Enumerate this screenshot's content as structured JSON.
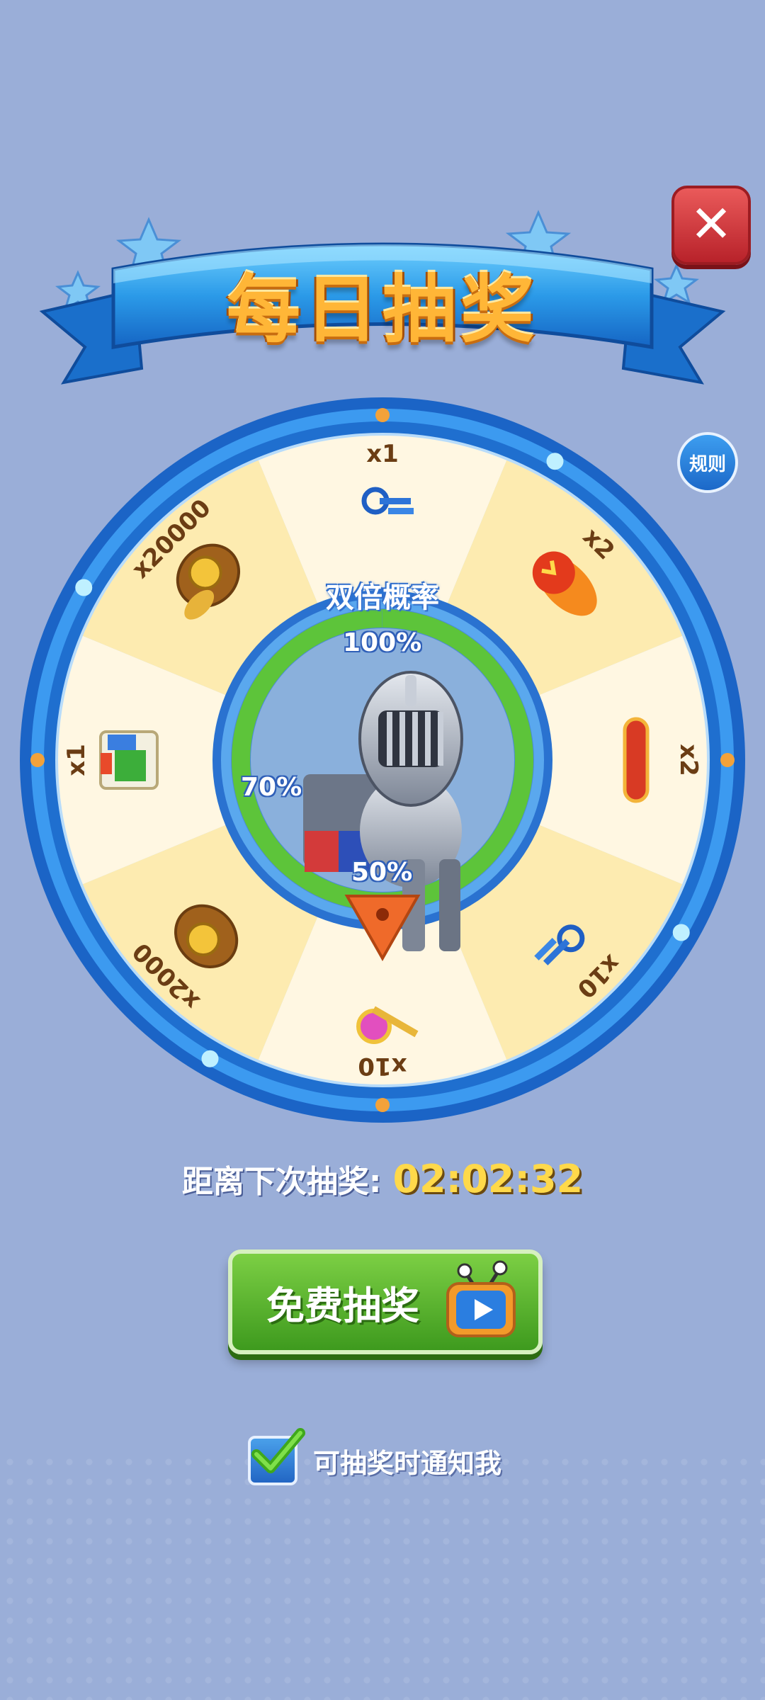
{
  "header": {
    "title": "每日抽奖",
    "close_icon": "close-icon",
    "rules_label": "规则"
  },
  "wheel": {
    "double_chance_label": "双倍概率",
    "progress": {
      "labels": [
        "100%",
        "70%",
        "50%"
      ],
      "value_percent": 100
    },
    "slots": [
      {
        "reward": "blue-keys-icon",
        "amount": "x1"
      },
      {
        "reward": "fireball-icon",
        "amount": "x2"
      },
      {
        "reward": "red-skateboard-icon",
        "amount": "x2"
      },
      {
        "reward": "blue-keys-icon",
        "amount": "x10"
      },
      {
        "reward": "golden-key-icon",
        "amount": "x10"
      },
      {
        "reward": "coin-bag-icon",
        "amount": "x2000"
      },
      {
        "reward": "mystery-box-icon",
        "amount": "x1"
      },
      {
        "reward": "coin-bags-icon",
        "amount": "x20000"
      }
    ],
    "colors": {
      "slot_a": "#fdebb0",
      "slot_b": "#fff7e2",
      "rim": "#1f6fcf",
      "ring_green": "#5dc43a"
    }
  },
  "countdown": {
    "label": "距离下次抽奖:",
    "time": "02:02:32"
  },
  "free_spin_button": {
    "label": "免费抽奖",
    "icon": "tv-play-icon"
  },
  "notify": {
    "checked": true,
    "label": "可抽奖时通知我"
  }
}
